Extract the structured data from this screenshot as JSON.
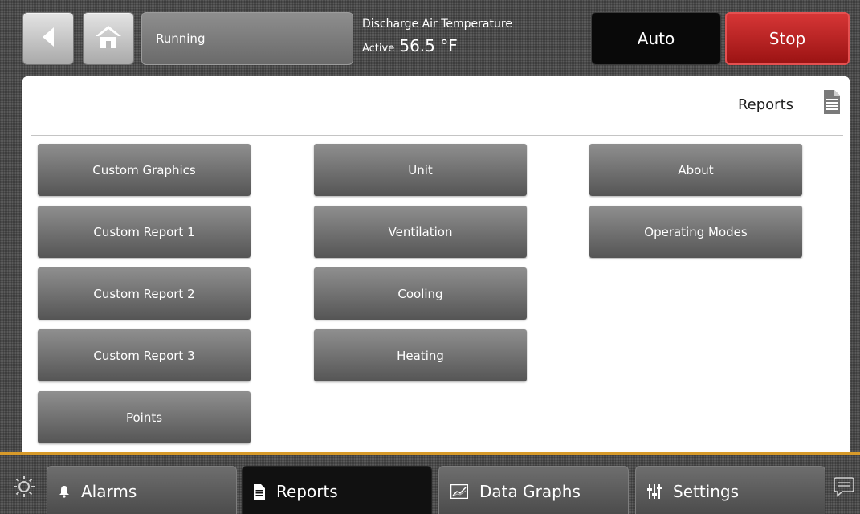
{
  "header": {
    "status_text": "Running",
    "point_name": "Discharge Air Temperature",
    "point_state": "Active",
    "point_value": "56.5 °F",
    "mode_label": "Auto",
    "stop_label": "Stop",
    "stop_color": "#c0201f"
  },
  "page": {
    "title": "Reports",
    "icon": "document-icon"
  },
  "menu": {
    "col1": [
      "Custom Graphics",
      "Custom Report 1",
      "Custom Report 2",
      "Custom Report 3",
      "Points"
    ],
    "col2": [
      "Unit",
      "Ventilation",
      "Cooling",
      "Heating"
    ],
    "col3": [
      "About",
      "Operating Modes"
    ]
  },
  "tabs": [
    {
      "label": "Alarms",
      "icon": "bell-icon"
    },
    {
      "label": "Reports",
      "icon": "document-icon",
      "active": true
    },
    {
      "label": "Data Graphs",
      "icon": "chart-icon"
    },
    {
      "label": "Settings",
      "icon": "sliders-icon"
    }
  ],
  "colors": {
    "accent_line": "#d79a2a",
    "button_gray": "#707070"
  }
}
